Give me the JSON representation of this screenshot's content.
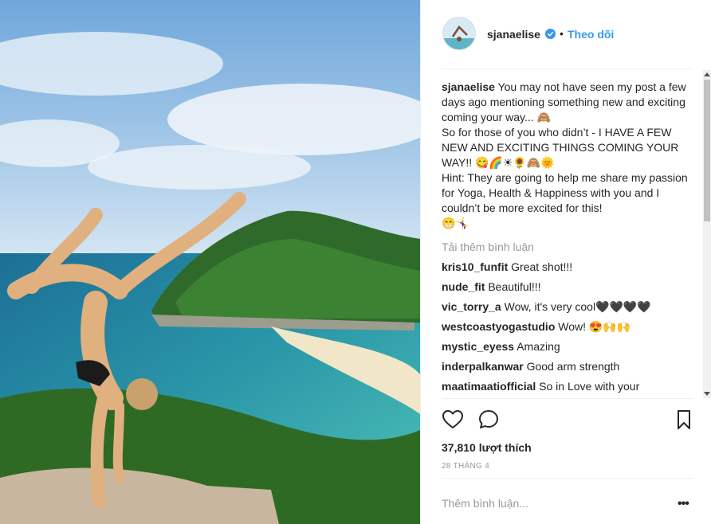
{
  "header": {
    "username": "sjanaelise",
    "dot": "•",
    "follow_label": "Theo dõi"
  },
  "caption": {
    "username": "sjanaelise",
    "text": "You may not have seen my post a few days ago mentioning something new and exciting coming your way... 🙈\nSo for those of you who didn’t - I HAVE A FEW NEW AND EXCITING THINGS COMING YOUR WAY!! 😋🌈☀🌻🙈🌞\nHint: They are going to help me share my passion for Yoga, Health & Happiness with you and I couldn’t be more excited for this!\n😁🤸‍♀️"
  },
  "load_more_label": "Tải thêm bình luận",
  "comments": [
    {
      "user": "kris10_funfit",
      "text": "Great shot!!!"
    },
    {
      "user": "nude_fit",
      "text": "Beautiful!!!"
    },
    {
      "user": "vic_torry_a",
      "text": "Wow, it's very cool🖤🖤🖤🖤"
    },
    {
      "user": "westcoastyogastudio",
      "text": "Wow! 😍🙌🙌"
    },
    {
      "user": "mystic_eyess",
      "text": "Amazing"
    },
    {
      "user": "inderpalkanwar",
      "text": "Good arm strength"
    },
    {
      "user": "maatimaatiofficial",
      "text": "So in Love with your"
    }
  ],
  "likes": "37,810 lượt thích",
  "date": "28 THÁNG 4",
  "add_comment_placeholder": "Thêm bình luận...",
  "more_options": "•••",
  "icons": {
    "verified": "verified-badge-icon",
    "like": "heart-icon",
    "comment": "comment-icon",
    "save": "bookmark-icon"
  },
  "colors": {
    "link": "#3897f0",
    "muted": "#999999",
    "text": "#262626"
  }
}
